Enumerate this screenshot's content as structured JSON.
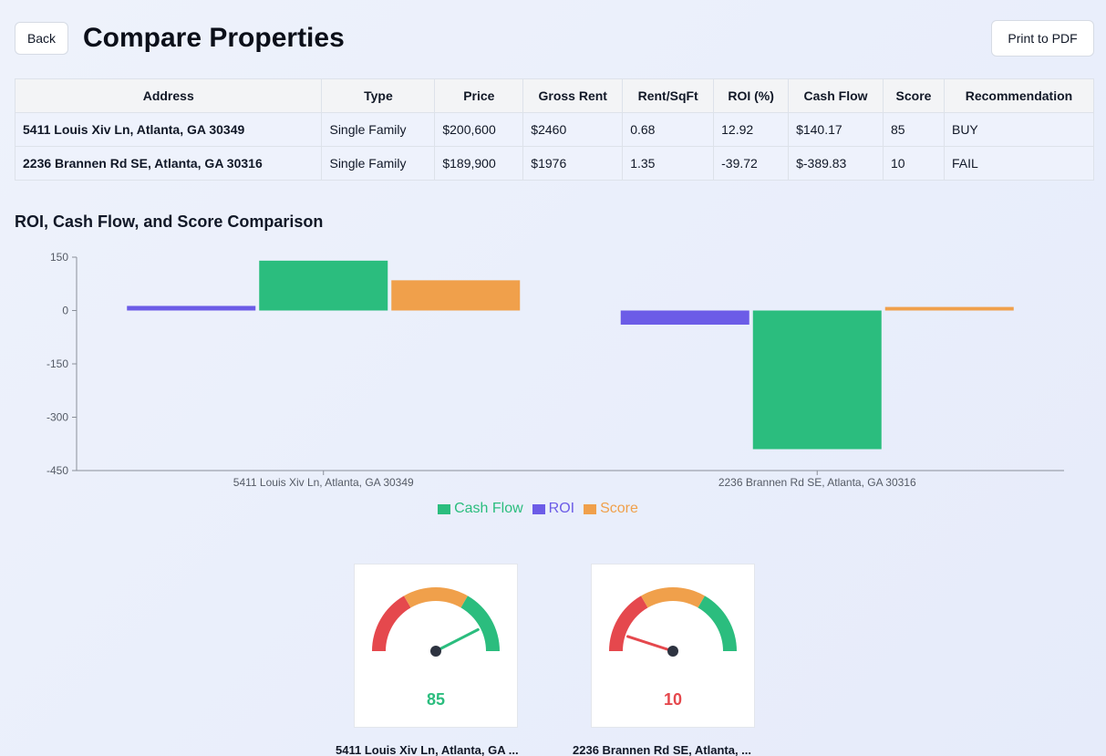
{
  "header": {
    "back_label": "Back",
    "title": "Compare Properties",
    "print_label": "Print to PDF"
  },
  "table": {
    "columns": [
      "Address",
      "Type",
      "Price",
      "Gross Rent",
      "Rent/SqFt",
      "ROI (%)",
      "Cash Flow",
      "Score",
      "Recommendation"
    ],
    "rows": [
      [
        "5411 Louis Xiv Ln, Atlanta, GA 30349",
        "Single Family",
        "$200,600",
        "$2460",
        "0.68",
        "12.92",
        "$140.17",
        "85",
        "BUY"
      ],
      [
        "2236 Brannen Rd SE, Atlanta, GA 30316",
        "Single Family",
        "$189,900",
        "$1976",
        "1.35",
        "-39.72",
        "$-389.83",
        "10",
        "FAIL"
      ]
    ]
  },
  "chart_section_title": "ROI, Cash Flow, and Score Comparison",
  "chart_data": {
    "type": "bar",
    "title": "ROI, Cash Flow, and Score Comparison",
    "categories": [
      "5411 Louis Xiv Ln, Atlanta, GA 30349",
      "2236 Brannen Rd SE, Atlanta, GA 30316"
    ],
    "series": [
      {
        "name": "ROI",
        "values": [
          12.92,
          -39.72
        ],
        "color": "#6c5ce7"
      },
      {
        "name": "Cash Flow",
        "values": [
          140.17,
          -389.83
        ],
        "color": "#2bbd7e"
      },
      {
        "name": "Score",
        "values": [
          85,
          10
        ],
        "color": "#f0a04b"
      }
    ],
    "yticks": [
      150,
      0,
      -150,
      -300,
      -450
    ],
    "ylim": [
      -450,
      150
    ],
    "grid": false,
    "legend_position": "bottom",
    "legend": [
      {
        "name": "Cash Flow",
        "color": "#2bbd7e"
      },
      {
        "name": "ROI",
        "color": "#6c5ce7"
      },
      {
        "name": "Score",
        "color": "#f0a04b"
      }
    ]
  },
  "gauges": [
    {
      "value": 85,
      "value_text": "85",
      "value_color": "#2bbd7e",
      "needle_color": "#2bbd7e",
      "label": "5411 Louis Xiv Ln, Atlanta, GA ..."
    },
    {
      "value": 10,
      "value_text": "10",
      "value_color": "#e5484d",
      "needle_color": "#e5484d",
      "label": "2236 Brannen Rd SE, Atlanta, ..."
    }
  ],
  "gauge_zone_colors": [
    "#e5484d",
    "#f0a04b",
    "#2bbd7e"
  ]
}
